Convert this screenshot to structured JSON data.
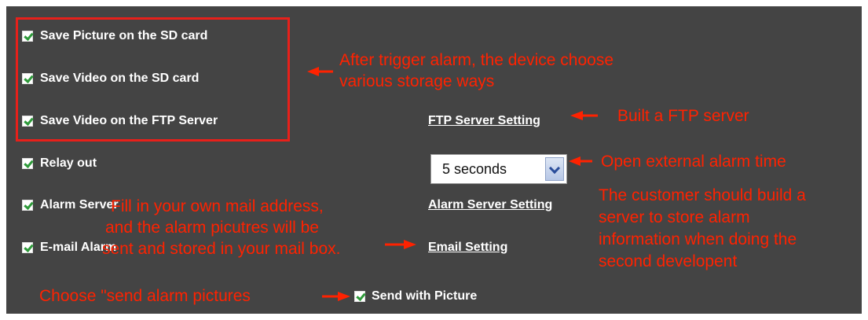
{
  "options": {
    "save_picture_sd": "Save Picture on the SD card",
    "save_video_sd": "Save Video on the SD card",
    "save_video_ftp": "Save Video on the FTP Server",
    "relay_out": "Relay out",
    "alarm_server": "Alarm Server",
    "email_alarm": "E-mail Alarm",
    "send_with_picture": "Send with Picture"
  },
  "links": {
    "ftp_server_setting": "FTP Server Setting",
    "alarm_server_setting": "Alarm Server Setting",
    "email_setting": "Email Setting"
  },
  "relay_duration": {
    "selected": "5 seconds"
  },
  "annotations": {
    "storage_line1": "After trigger alarm, the device choose",
    "storage_line2": "various storage ways",
    "ftp": "Built a FTP server",
    "relay": "Open external alarm time",
    "server_line1": "The customer should build a",
    "server_line2": "server to store alarm",
    "server_line3": "information when doing the",
    "server_line4": "second developent",
    "mail_line1": "Fill in your own mail address,",
    "mail_line2": "and the alarm picutres will be",
    "mail_line3": "sent and stored in your mail box.",
    "pictures": "Choose \"send alarm pictures"
  },
  "colors": {
    "background": "#444444",
    "annotation": "#ff2200",
    "highlight_box": "#e8201a",
    "check": "#2e9a3a"
  }
}
